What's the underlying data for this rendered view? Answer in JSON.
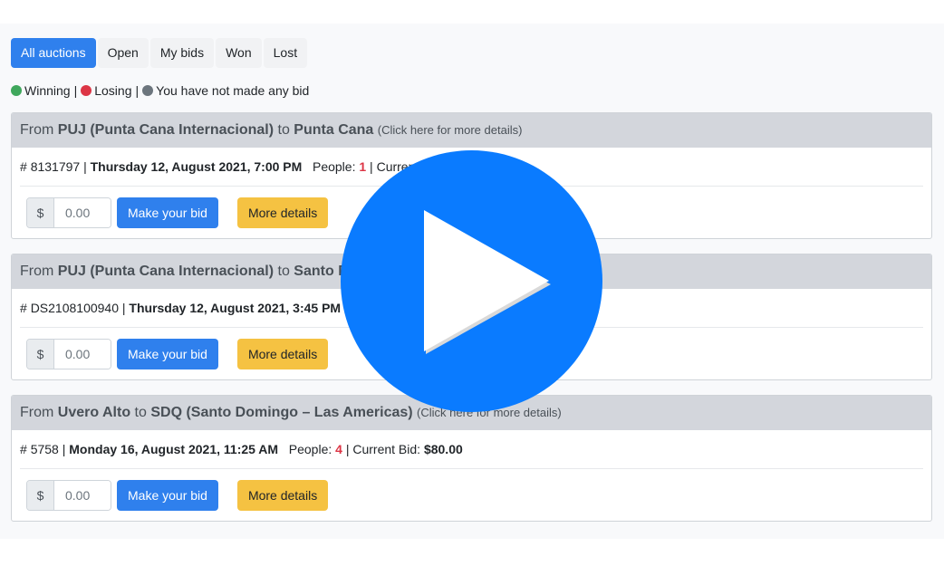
{
  "tabs": [
    {
      "label": "All auctions",
      "active": true
    },
    {
      "label": "Open",
      "active": false
    },
    {
      "label": "My bids",
      "active": false
    },
    {
      "label": "Won",
      "active": false
    },
    {
      "label": "Lost",
      "active": false
    }
  ],
  "legend": {
    "winning": {
      "label": "Winning",
      "color": "#3fa75c"
    },
    "losing": {
      "label": "Losing",
      "color": "#dc3545"
    },
    "none": {
      "label": "You have not made any bid",
      "color": "#6c757d"
    },
    "separator": "|"
  },
  "common": {
    "from": "From",
    "to": "to",
    "details_hint": "(Click here for more details)",
    "hash": "#",
    "pipe": "|",
    "people_label": "People:",
    "current_bid_label": "Current Bid:",
    "currency": "$",
    "bid_placeholder": "0.00",
    "make_bid": "Make your bid",
    "more_details": "More details"
  },
  "auctions": [
    {
      "origin": "PUJ (Punta Cana Internacional)",
      "destination": "Punta Cana",
      "id": "8131797",
      "datetime": "Thursday 12, August 2021, 7:00 PM",
      "people": "1",
      "current_bid_fragment": "Current"
    },
    {
      "origin": "PUJ (Punta Cana Internacional)",
      "destination": "Santo D",
      "id": "DS2108100940",
      "datetime": "Thursday 12, August 2021, 3:45 PM"
    },
    {
      "origin": "Uvero Alto",
      "destination": "SDQ (Santo Domingo – Las Americas)",
      "id": "5758",
      "datetime": "Monday 16, August 2021, 11:25 AM",
      "people": "4",
      "current_bid": "$80.00"
    }
  ],
  "overlay": {
    "icon": "play-icon",
    "color": "#0a7bff"
  }
}
